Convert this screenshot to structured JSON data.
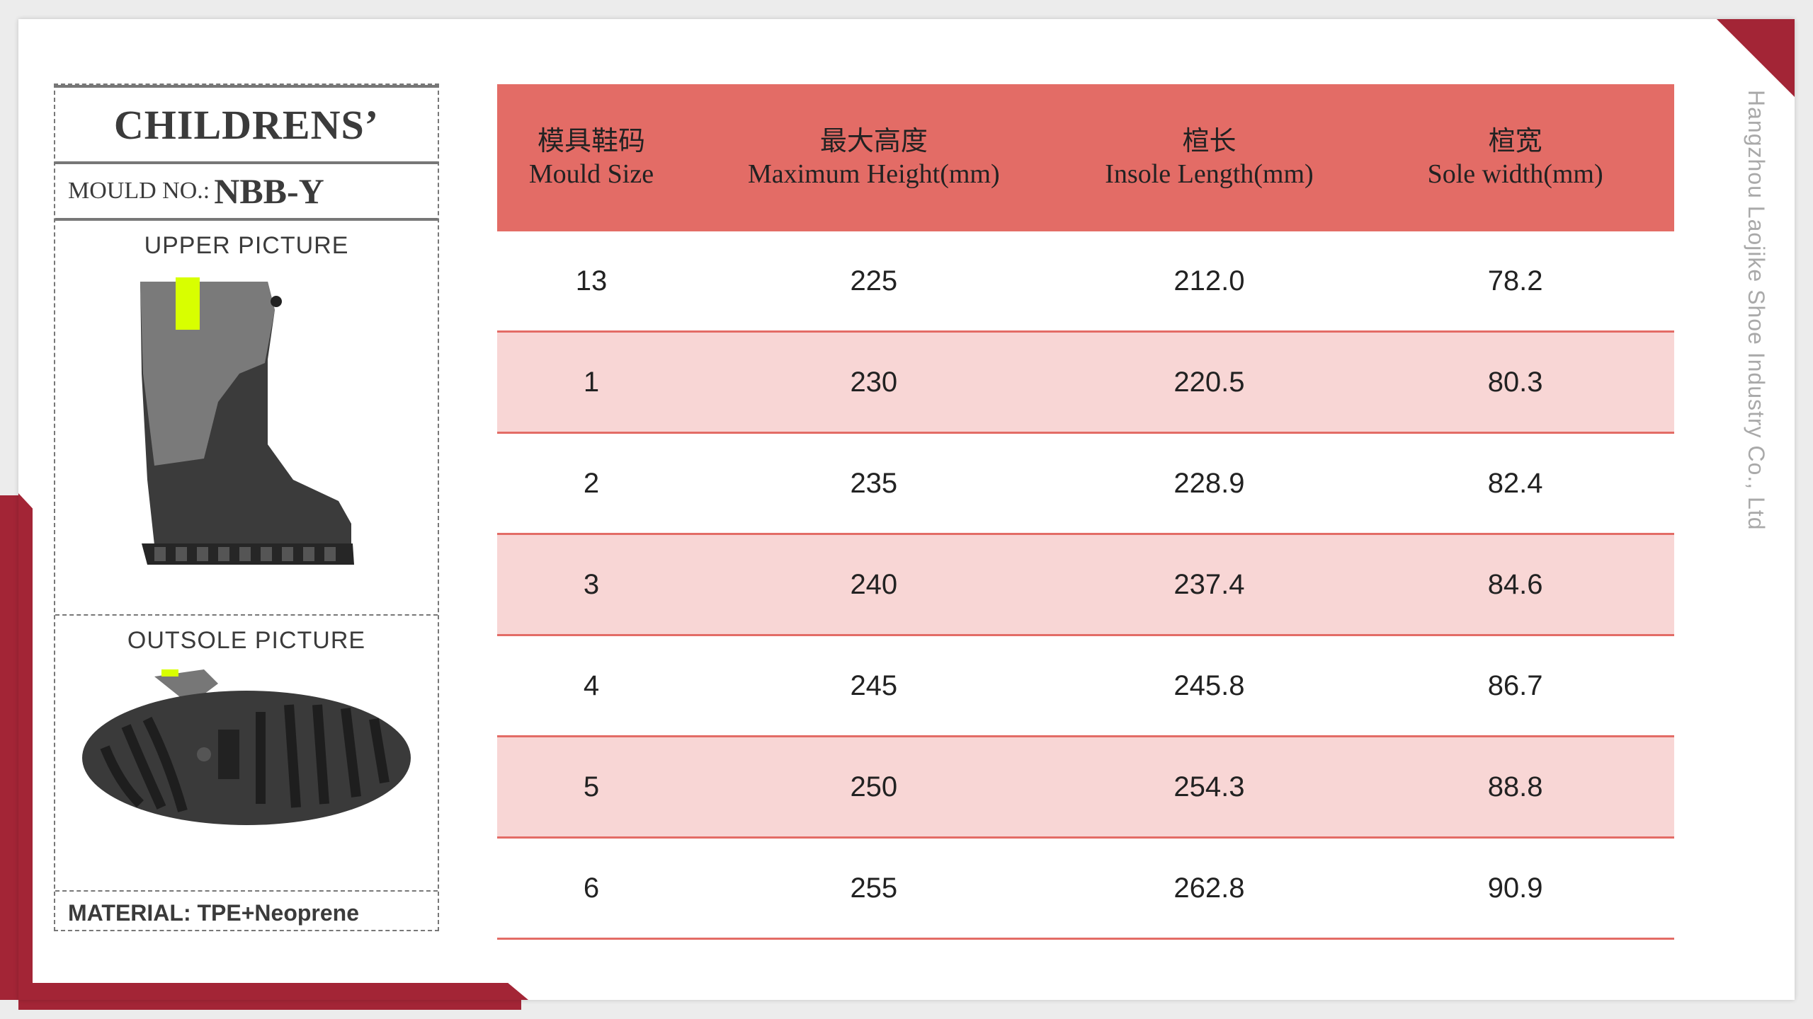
{
  "panel": {
    "title": "CHILDRENS’",
    "mould_label": "MOULD NO.:",
    "mould_value": "NBB-Y",
    "upper_label": "UPPER PICTURE",
    "outsole_label": "OUTSOLE PICTURE",
    "material": "MATERIAL: TPE+Neoprene"
  },
  "table": {
    "headers": [
      {
        "cn": "模具鞋码",
        "en": "Mould Size"
      },
      {
        "cn": "最大高度",
        "en": "Maximum Height(mm)"
      },
      {
        "cn": "楦长",
        "en": "Insole Length(mm)"
      },
      {
        "cn": "楦宽",
        "en": "Sole width(mm)"
      }
    ],
    "rows": [
      [
        "13",
        "225",
        "212.0",
        "78.2"
      ],
      [
        "1",
        "230",
        "220.5",
        "80.3"
      ],
      [
        "2",
        "235",
        "228.9",
        "82.4"
      ],
      [
        "3",
        "240",
        "237.4",
        "84.6"
      ],
      [
        "4",
        "245",
        "245.8",
        "86.7"
      ],
      [
        "5",
        "250",
        "254.3",
        "88.8"
      ],
      [
        "6",
        "255",
        "262.8",
        "90.9"
      ]
    ]
  },
  "side_text": "Hangzhou Laojike Shoe Industry Co., Ltd",
  "colors": {
    "accent": "#a32536",
    "header": "#e36c66",
    "row_alt": "#f8d6d5",
    "strap": "#d8ff00"
  }
}
